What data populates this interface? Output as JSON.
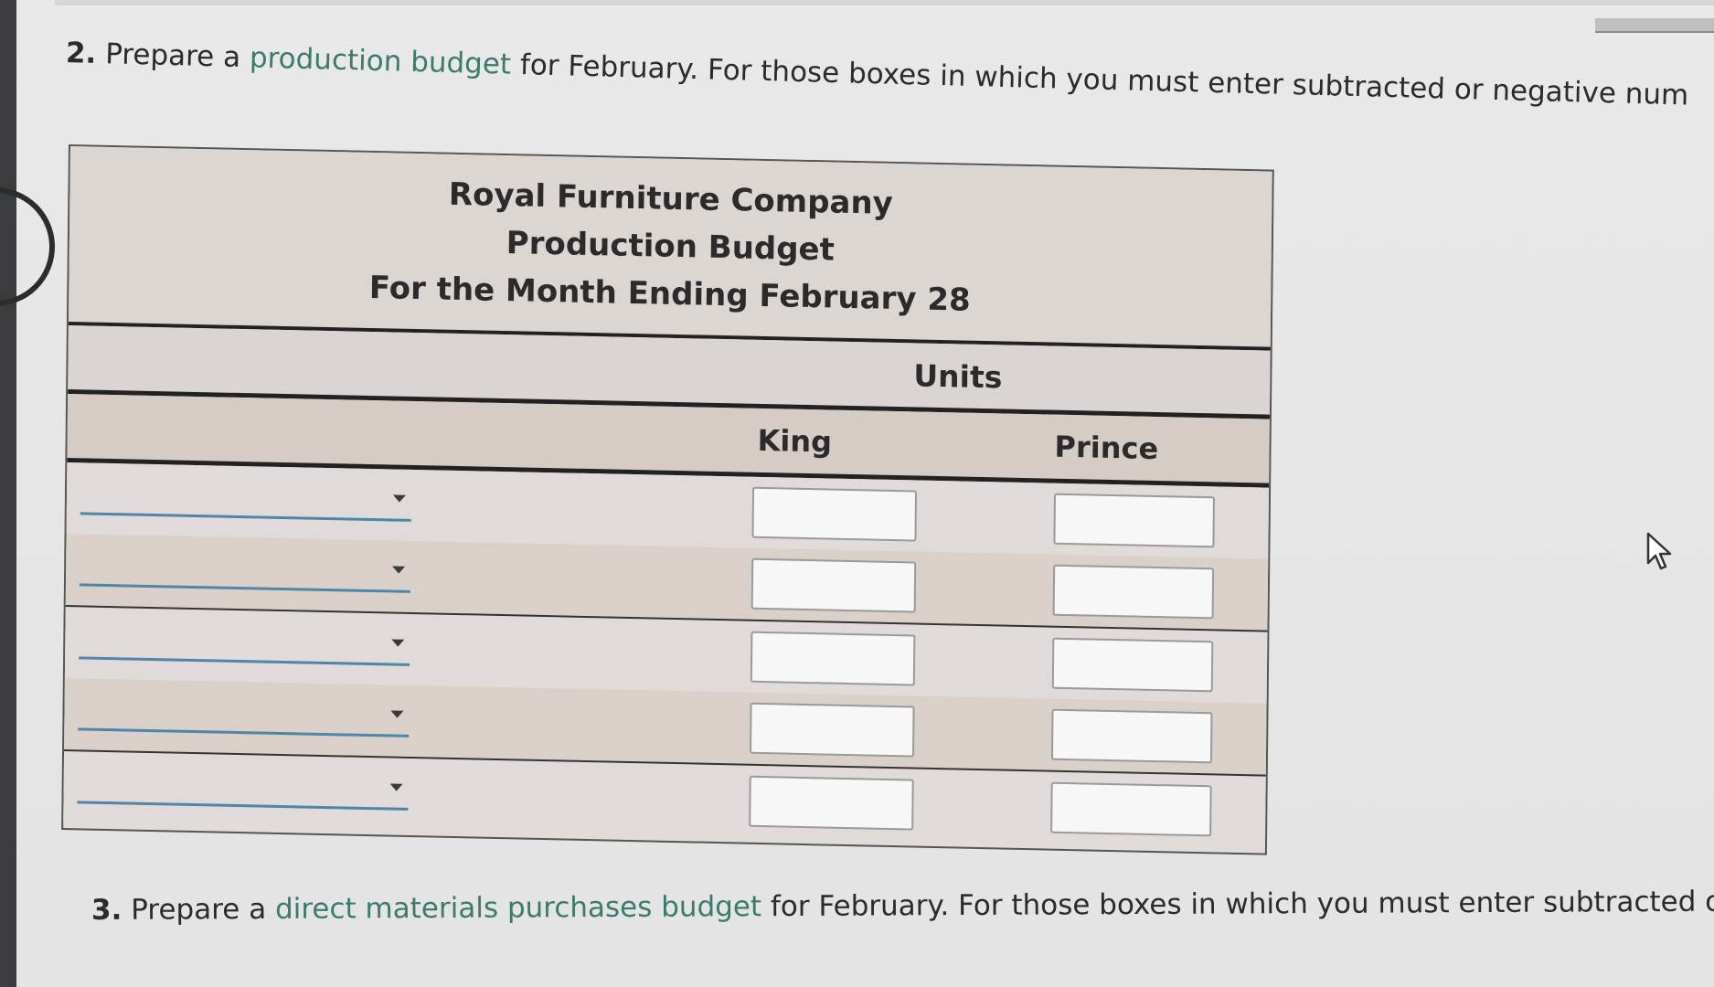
{
  "question2": {
    "number": "2.",
    "text_before": "Prepare a ",
    "link": "production budget",
    "text_after": " for February. For those boxes in which you must enter subtracted or negative num"
  },
  "budget": {
    "company": "Royal Furniture Company",
    "title": "Production Budget",
    "period": "For the Month Ending February 28",
    "units_header": "Units",
    "columns": [
      "King",
      "Prince"
    ],
    "rows": [
      {
        "label": "",
        "king": "",
        "prince": ""
      },
      {
        "label": "",
        "king": "",
        "prince": ""
      },
      {
        "label": "",
        "king": "",
        "prince": ""
      },
      {
        "label": "",
        "king": "",
        "prince": ""
      },
      {
        "label": "",
        "king": "",
        "prince": ""
      }
    ]
  },
  "question3": {
    "number": "3.",
    "text_before": "Prepare a ",
    "link": "direct materials purchases budget",
    "text_after": " for February. For those boxes in which you must enter subtracted or neg"
  }
}
